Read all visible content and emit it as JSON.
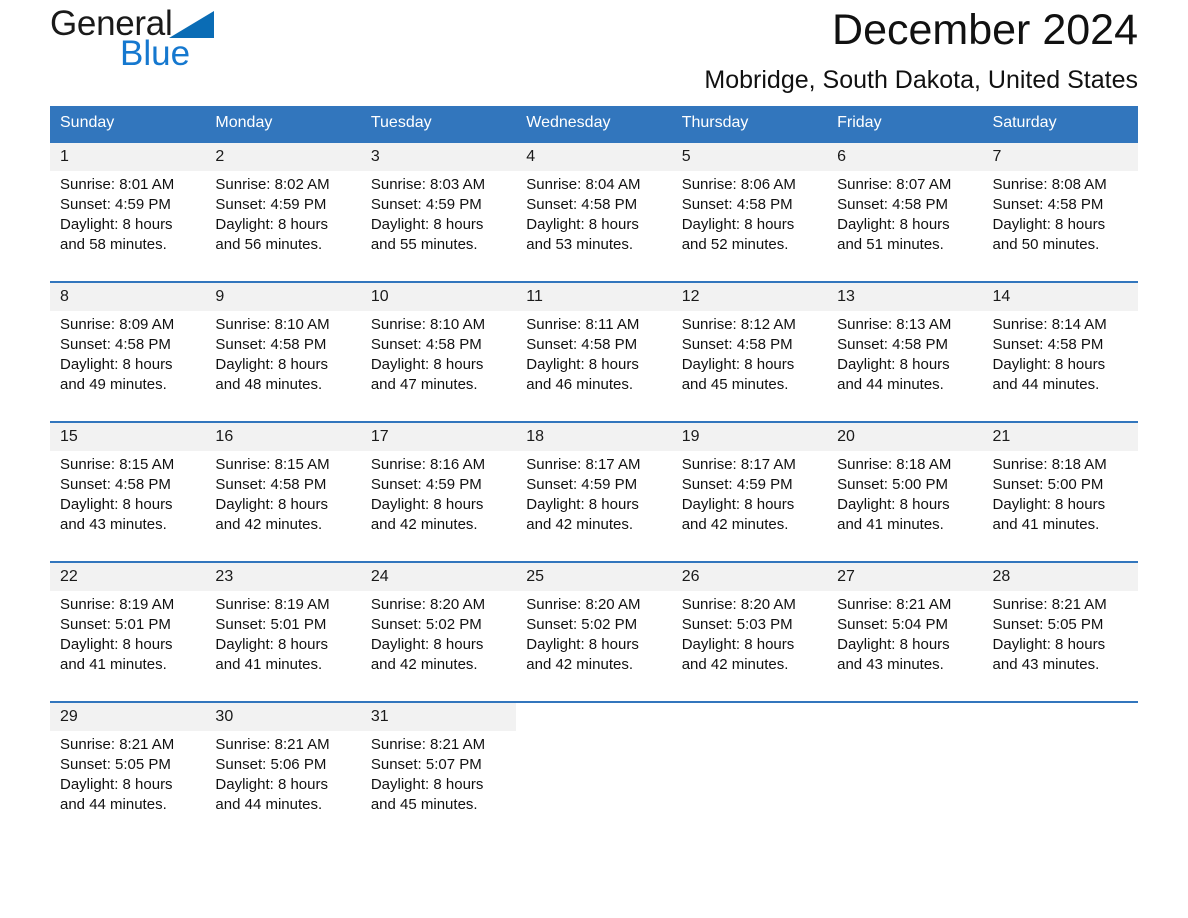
{
  "brand": {
    "name_part1": "General",
    "name_part2": "Blue",
    "triangle_color": "#0a6cb5",
    "blue_text_color": "#1578cf"
  },
  "header": {
    "title": "December 2024",
    "subtitle": "Mobridge, South Dakota, United States"
  },
  "theme": {
    "header_blue": "#3276bd",
    "daynum_band": "#f2f2f2",
    "page_background": "#ffffff"
  },
  "calendar": {
    "weekday_headers": [
      "Sunday",
      "Monday",
      "Tuesday",
      "Wednesday",
      "Thursday",
      "Friday",
      "Saturday"
    ],
    "weeks": [
      [
        {
          "day": "1",
          "sunrise": "Sunrise: 8:01 AM",
          "sunset": "Sunset: 4:59 PM",
          "daylight_line1": "Daylight: 8 hours",
          "daylight_line2": "and 58 minutes."
        },
        {
          "day": "2",
          "sunrise": "Sunrise: 8:02 AM",
          "sunset": "Sunset: 4:59 PM",
          "daylight_line1": "Daylight: 8 hours",
          "daylight_line2": "and 56 minutes."
        },
        {
          "day": "3",
          "sunrise": "Sunrise: 8:03 AM",
          "sunset": "Sunset: 4:59 PM",
          "daylight_line1": "Daylight: 8 hours",
          "daylight_line2": "and 55 minutes."
        },
        {
          "day": "4",
          "sunrise": "Sunrise: 8:04 AM",
          "sunset": "Sunset: 4:58 PM",
          "daylight_line1": "Daylight: 8 hours",
          "daylight_line2": "and 53 minutes."
        },
        {
          "day": "5",
          "sunrise": "Sunrise: 8:06 AM",
          "sunset": "Sunset: 4:58 PM",
          "daylight_line1": "Daylight: 8 hours",
          "daylight_line2": "and 52 minutes."
        },
        {
          "day": "6",
          "sunrise": "Sunrise: 8:07 AM",
          "sunset": "Sunset: 4:58 PM",
          "daylight_line1": "Daylight: 8 hours",
          "daylight_line2": "and 51 minutes."
        },
        {
          "day": "7",
          "sunrise": "Sunrise: 8:08 AM",
          "sunset": "Sunset: 4:58 PM",
          "daylight_line1": "Daylight: 8 hours",
          "daylight_line2": "and 50 minutes."
        }
      ],
      [
        {
          "day": "8",
          "sunrise": "Sunrise: 8:09 AM",
          "sunset": "Sunset: 4:58 PM",
          "daylight_line1": "Daylight: 8 hours",
          "daylight_line2": "and 49 minutes."
        },
        {
          "day": "9",
          "sunrise": "Sunrise: 8:10 AM",
          "sunset": "Sunset: 4:58 PM",
          "daylight_line1": "Daylight: 8 hours",
          "daylight_line2": "and 48 minutes."
        },
        {
          "day": "10",
          "sunrise": "Sunrise: 8:10 AM",
          "sunset": "Sunset: 4:58 PM",
          "daylight_line1": "Daylight: 8 hours",
          "daylight_line2": "and 47 minutes."
        },
        {
          "day": "11",
          "sunrise": "Sunrise: 8:11 AM",
          "sunset": "Sunset: 4:58 PM",
          "daylight_line1": "Daylight: 8 hours",
          "daylight_line2": "and 46 minutes."
        },
        {
          "day": "12",
          "sunrise": "Sunrise: 8:12 AM",
          "sunset": "Sunset: 4:58 PM",
          "daylight_line1": "Daylight: 8 hours",
          "daylight_line2": "and 45 minutes."
        },
        {
          "day": "13",
          "sunrise": "Sunrise: 8:13 AM",
          "sunset": "Sunset: 4:58 PM",
          "daylight_line1": "Daylight: 8 hours",
          "daylight_line2": "and 44 minutes."
        },
        {
          "day": "14",
          "sunrise": "Sunrise: 8:14 AM",
          "sunset": "Sunset: 4:58 PM",
          "daylight_line1": "Daylight: 8 hours",
          "daylight_line2": "and 44 minutes."
        }
      ],
      [
        {
          "day": "15",
          "sunrise": "Sunrise: 8:15 AM",
          "sunset": "Sunset: 4:58 PM",
          "daylight_line1": "Daylight: 8 hours",
          "daylight_line2": "and 43 minutes."
        },
        {
          "day": "16",
          "sunrise": "Sunrise: 8:15 AM",
          "sunset": "Sunset: 4:58 PM",
          "daylight_line1": "Daylight: 8 hours",
          "daylight_line2": "and 42 minutes."
        },
        {
          "day": "17",
          "sunrise": "Sunrise: 8:16 AM",
          "sunset": "Sunset: 4:59 PM",
          "daylight_line1": "Daylight: 8 hours",
          "daylight_line2": "and 42 minutes."
        },
        {
          "day": "18",
          "sunrise": "Sunrise: 8:17 AM",
          "sunset": "Sunset: 4:59 PM",
          "daylight_line1": "Daylight: 8 hours",
          "daylight_line2": "and 42 minutes."
        },
        {
          "day": "19",
          "sunrise": "Sunrise: 8:17 AM",
          "sunset": "Sunset: 4:59 PM",
          "daylight_line1": "Daylight: 8 hours",
          "daylight_line2": "and 42 minutes."
        },
        {
          "day": "20",
          "sunrise": "Sunrise: 8:18 AM",
          "sunset": "Sunset: 5:00 PM",
          "daylight_line1": "Daylight: 8 hours",
          "daylight_line2": "and 41 minutes."
        },
        {
          "day": "21",
          "sunrise": "Sunrise: 8:18 AM",
          "sunset": "Sunset: 5:00 PM",
          "daylight_line1": "Daylight: 8 hours",
          "daylight_line2": "and 41 minutes."
        }
      ],
      [
        {
          "day": "22",
          "sunrise": "Sunrise: 8:19 AM",
          "sunset": "Sunset: 5:01 PM",
          "daylight_line1": "Daylight: 8 hours",
          "daylight_line2": "and 41 minutes."
        },
        {
          "day": "23",
          "sunrise": "Sunrise: 8:19 AM",
          "sunset": "Sunset: 5:01 PM",
          "daylight_line1": "Daylight: 8 hours",
          "daylight_line2": "and 41 minutes."
        },
        {
          "day": "24",
          "sunrise": "Sunrise: 8:20 AM",
          "sunset": "Sunset: 5:02 PM",
          "daylight_line1": "Daylight: 8 hours",
          "daylight_line2": "and 42 minutes."
        },
        {
          "day": "25",
          "sunrise": "Sunrise: 8:20 AM",
          "sunset": "Sunset: 5:02 PM",
          "daylight_line1": "Daylight: 8 hours",
          "daylight_line2": "and 42 minutes."
        },
        {
          "day": "26",
          "sunrise": "Sunrise: 8:20 AM",
          "sunset": "Sunset: 5:03 PM",
          "daylight_line1": "Daylight: 8 hours",
          "daylight_line2": "and 42 minutes."
        },
        {
          "day": "27",
          "sunrise": "Sunrise: 8:21 AM",
          "sunset": "Sunset: 5:04 PM",
          "daylight_line1": "Daylight: 8 hours",
          "daylight_line2": "and 43 minutes."
        },
        {
          "day": "28",
          "sunrise": "Sunrise: 8:21 AM",
          "sunset": "Sunset: 5:05 PM",
          "daylight_line1": "Daylight: 8 hours",
          "daylight_line2": "and 43 minutes."
        }
      ],
      [
        {
          "day": "29",
          "sunrise": "Sunrise: 8:21 AM",
          "sunset": "Sunset: 5:05 PM",
          "daylight_line1": "Daylight: 8 hours",
          "daylight_line2": "and 44 minutes."
        },
        {
          "day": "30",
          "sunrise": "Sunrise: 8:21 AM",
          "sunset": "Sunset: 5:06 PM",
          "daylight_line1": "Daylight: 8 hours",
          "daylight_line2": "and 44 minutes."
        },
        {
          "day": "31",
          "sunrise": "Sunrise: 8:21 AM",
          "sunset": "Sunset: 5:07 PM",
          "daylight_line1": "Daylight: 8 hours",
          "daylight_line2": "and 45 minutes."
        },
        {
          "day": "",
          "sunrise": "",
          "sunset": "",
          "daylight_line1": "",
          "daylight_line2": ""
        },
        {
          "day": "",
          "sunrise": "",
          "sunset": "",
          "daylight_line1": "",
          "daylight_line2": ""
        },
        {
          "day": "",
          "sunrise": "",
          "sunset": "",
          "daylight_line1": "",
          "daylight_line2": ""
        },
        {
          "day": "",
          "sunrise": "",
          "sunset": "",
          "daylight_line1": "",
          "daylight_line2": ""
        }
      ]
    ]
  }
}
